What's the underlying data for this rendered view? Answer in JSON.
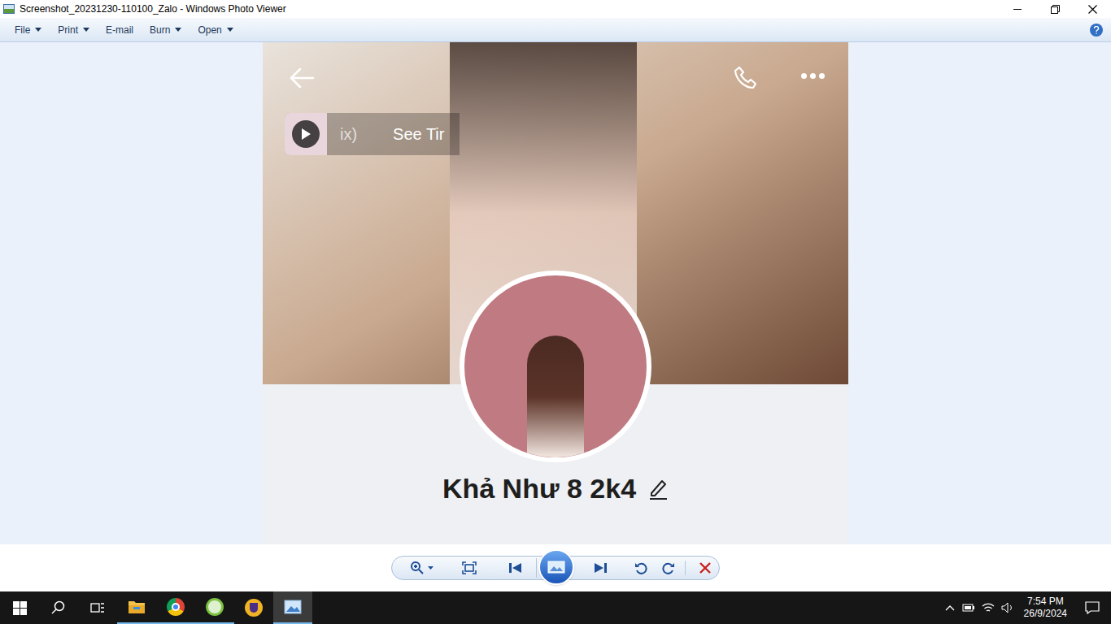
{
  "window": {
    "title": "Screenshot_20231230-110100_Zalo - Windows Photo Viewer"
  },
  "menu": [
    {
      "label": "File",
      "dropdown": true
    },
    {
      "label": "Print",
      "dropdown": true
    },
    {
      "label": "E-mail",
      "dropdown": false
    },
    {
      "label": "Burn",
      "dropdown": true
    },
    {
      "label": "Open",
      "dropdown": true
    }
  ],
  "profile": {
    "music_chip": {
      "track": "ix)",
      "link": "See Tir"
    },
    "name": "Khả Như 8 2k4"
  },
  "taskbar": {
    "time": "7:54 PM",
    "date": "26/9/2024"
  }
}
